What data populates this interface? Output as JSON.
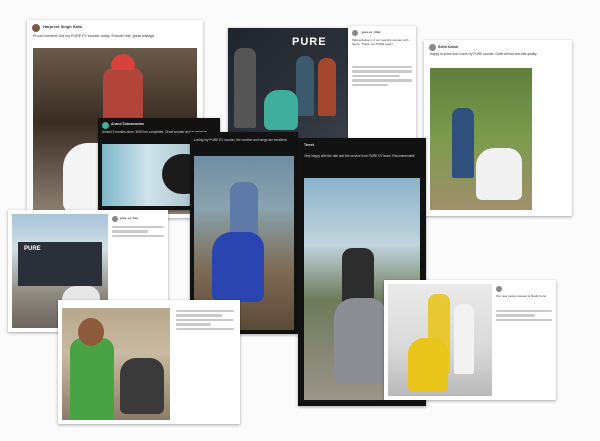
{
  "collage": {
    "posts": [
      {
        "id": "p1",
        "author": "Harpreet Singh Kalsi",
        "caption": "Proud moment! Got my PURE EV scooter today. Smooth ride, great mileage.",
        "style": "light"
      },
      {
        "id": "p2",
        "author": "",
        "caption": "",
        "brand": "PURE",
        "style": "light"
      },
      {
        "id": "p3",
        "author": "_pure.ev_rider",
        "caption": "Taking delivery of our new EV scooter with family. Thank you PURE team!",
        "style": "light"
      },
      {
        "id": "p4",
        "author": "Rohit Kumar",
        "caption": "Happy to share that I have my PURE scooter. Great service and ride quality.",
        "style": "light"
      },
      {
        "id": "p5",
        "author": "Anand Subramanian",
        "caption": "Almost 5 months done. 5000 km completed. Great scooter and experience.",
        "style": "dark"
      },
      {
        "id": "p6",
        "author": "",
        "caption": "Loving my PURE EV scooter, the comfort and range are excellent.",
        "style": "dark"
      },
      {
        "id": "p7",
        "author": "Tweet",
        "caption": "Very happy with the ride and the service from PURE EV team. Recommended!",
        "style": "dark"
      },
      {
        "id": "p8",
        "author": "pure_ev_fan",
        "caption": "",
        "brand": "PURE",
        "style": "light"
      },
      {
        "id": "p9",
        "author": "",
        "caption": "",
        "style": "light"
      },
      {
        "id": "p10",
        "author": "",
        "caption": "Our new yellow scooter is finally here!",
        "style": "light"
      }
    ],
    "colors": {
      "ev_teal": "#3fae9a",
      "scooter_blue": "#2a45b0",
      "scooter_yellow": "#e8c51a",
      "scooter_white": "#eeeeee"
    }
  }
}
